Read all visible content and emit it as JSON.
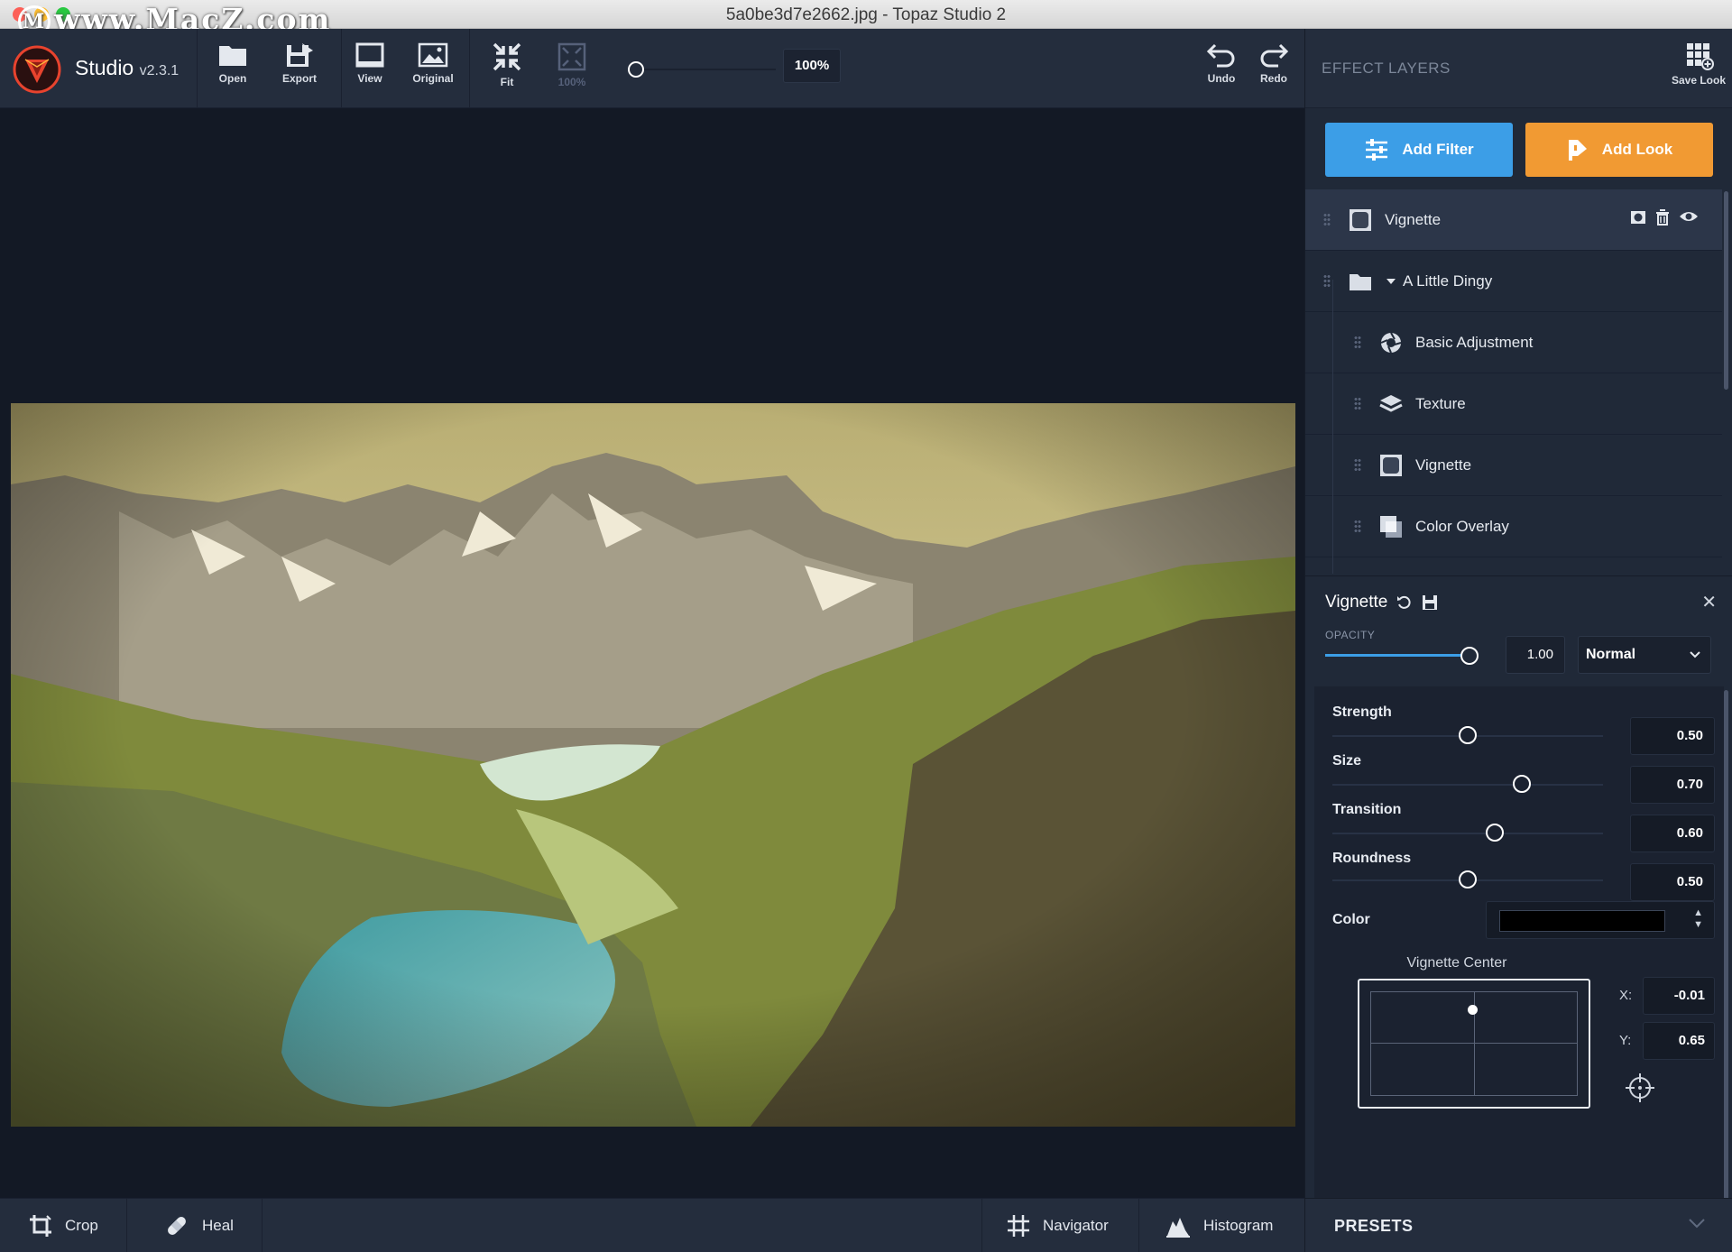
{
  "window": {
    "title": "5a0be3d7e2662.jpg - Topaz Studio 2",
    "watermark": "www.MacZ.com",
    "watermark_initial": "M"
  },
  "toolbar": {
    "app_name": "Studio",
    "version": "v2.3.1",
    "open": "Open",
    "export": "Export",
    "view": "View",
    "original": "Original",
    "fit": "Fit",
    "hundred": "100%",
    "zoom_value": "100%",
    "undo": "Undo",
    "redo": "Redo"
  },
  "bottombar": {
    "crop": "Crop",
    "heal": "Heal",
    "navigator": "Navigator",
    "histogram": "Histogram"
  },
  "panel": {
    "title": "EFFECT LAYERS",
    "save_look": "Save Look",
    "add_filter": "Add Filter",
    "add_look": "Add Look",
    "layers": [
      {
        "label": "Vignette",
        "icon": "vignette-icon",
        "active": true
      },
      {
        "label": "A Little Dingy",
        "icon": "folder-icon"
      },
      {
        "label": "Basic Adjustment",
        "icon": "aperture-icon"
      },
      {
        "label": "Texture",
        "icon": "layers-icon"
      },
      {
        "label": "Vignette",
        "icon": "vignette-icon"
      },
      {
        "label": "Color Overlay",
        "icon": "overlay-icon"
      }
    ]
  },
  "properties": {
    "title": "Vignette",
    "opacity_label": "OPACITY",
    "opacity_value": "1.00",
    "opacity_fraction": 1.0,
    "blend_mode": "Normal",
    "sliders": [
      {
        "label": "Strength",
        "value": "0.50",
        "fraction": 0.5
      },
      {
        "label": "Size",
        "value": "0.70",
        "fraction": 0.7
      },
      {
        "label": "Transition",
        "value": "0.60",
        "fraction": 0.6
      },
      {
        "label": "Roundness",
        "value": "0.50",
        "fraction": 0.5
      }
    ],
    "color_label": "Color",
    "color_value": "#000000",
    "center_label": "Vignette Center",
    "x_label": "X:",
    "x_value": "-0.01",
    "y_label": "Y:",
    "y_value": "0.65"
  },
  "presets": {
    "label": "PRESETS"
  },
  "colors": {
    "accent_blue": "#3c9ee7",
    "accent_orange": "#f19a33",
    "panel_bg": "#202938",
    "toolbar_bg": "#242d3d",
    "canvas_bg": "#131925"
  }
}
